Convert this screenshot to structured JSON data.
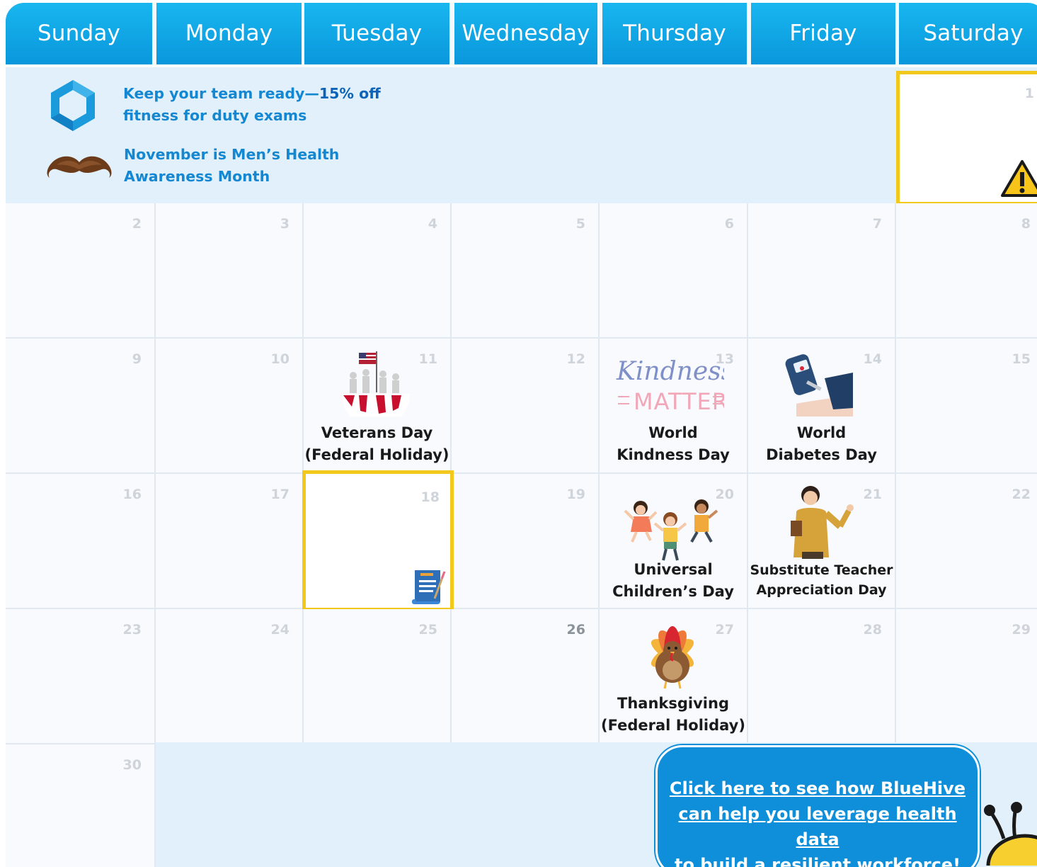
{
  "calendar": {
    "days": [
      "Sunday",
      "Monday",
      "Tuesday",
      "Wednesday",
      "Thursday",
      "Friday",
      "Saturday"
    ],
    "accent": "#0a97dc",
    "highlight_color": "#f3c81c",
    "promo": {
      "fitness_text": "Keep your team ready—",
      "fitness_bold": "15% off",
      "fitness_text2": "fitness for duty exams",
      "mens_health_line1": "November is Men’s Health",
      "mens_health_line2": "Awareness Month"
    },
    "dates": {
      "d1": "1",
      "d2": "2",
      "d3": "3",
      "d4": "4",
      "d5": "5",
      "d6": "6",
      "d7": "7",
      "d8": "8",
      "d9": "9",
      "d10": "10",
      "d11": "11",
      "d12": "12",
      "d13": "13",
      "d14": "14",
      "d15": "15",
      "d16": "16",
      "d17": "17",
      "d18": "18",
      "d19": "19",
      "d20": "20",
      "d21": "21",
      "d22": "22",
      "d23": "23",
      "d24": "24",
      "d25": "25",
      "d26": "26",
      "d27": "27",
      "d28": "28",
      "d29": "29",
      "d30": "30"
    },
    "events": {
      "veterans_1": "Veterans Day",
      "veterans_2": "(Federal Holiday)",
      "kindness_1": "World",
      "kindness_2": "Kindness Day",
      "diabetes_1": "World",
      "diabetes_2": "Diabetes Day",
      "children_1": "Universal",
      "children_2": "Children’s Day",
      "teacher_1": "Substitute Teacher",
      "teacher_2": "Appreciation Day",
      "thanks_1": "Thanksgiving",
      "thanks_2": "(Federal Holiday)"
    },
    "cta": {
      "line1": "Click here to see how BlueHive",
      "line2": "can help you leverage health data",
      "line3": "to build a resilient workforce!"
    }
  }
}
